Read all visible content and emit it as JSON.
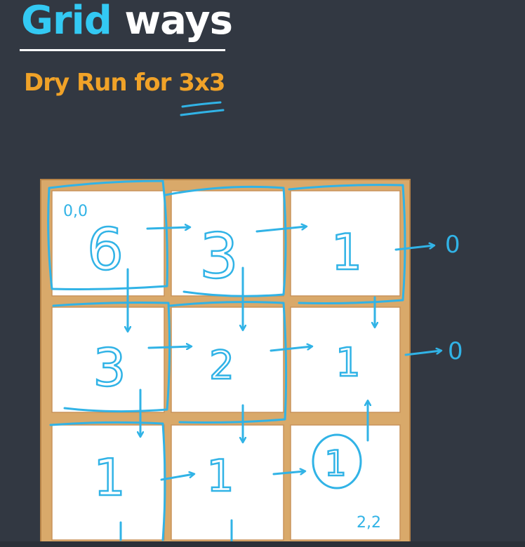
{
  "title": {
    "word1": "Grid",
    "word2": "ways"
  },
  "subtitle": {
    "prefix": "Dry Run for ",
    "highlight": "3x3"
  },
  "grid": {
    "rows": 3,
    "cols": 3,
    "cells": [
      [
        "6",
        "3",
        "1"
      ],
      [
        "3",
        "2",
        "1"
      ],
      [
        "1",
        "1",
        "1"
      ]
    ],
    "circled": [
      2,
      2
    ],
    "start_label": "0,0",
    "end_label": "2,2",
    "outside_values": [
      "0",
      "0"
    ]
  },
  "colors": {
    "background": "#323842",
    "title": "#33c9f3",
    "subtitle": "#f0a228",
    "ink": "#31b3e6",
    "frame": "#d9a96a"
  }
}
